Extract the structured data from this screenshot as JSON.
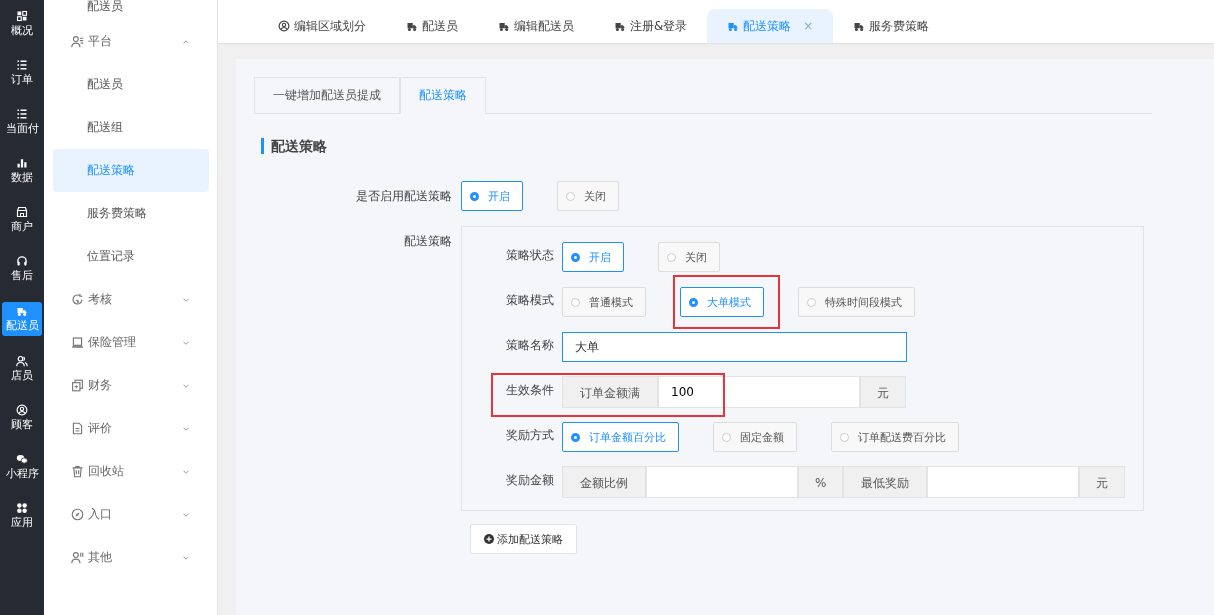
{
  "rail": [
    {
      "label": "概况",
      "selected": false
    },
    {
      "label": "订单",
      "selected": false
    },
    {
      "label": "当面付",
      "selected": false
    },
    {
      "label": "数据",
      "selected": false
    },
    {
      "label": "商户",
      "selected": false
    },
    {
      "label": "售后",
      "selected": false
    },
    {
      "label": "配送员",
      "selected": true
    },
    {
      "label": "店员",
      "selected": false
    },
    {
      "label": "顾客",
      "selected": false
    },
    {
      "label": "小程序",
      "selected": false
    },
    {
      "label": "应用",
      "selected": false
    }
  ],
  "sidebar": {
    "top_item": "配送员",
    "items": [
      {
        "label": "平台",
        "expanded": true,
        "children": [
          {
            "label": "配送员",
            "selected": false
          },
          {
            "label": "配送组",
            "selected": false
          },
          {
            "label": "配送策略",
            "selected": true
          },
          {
            "label": "服务费策略",
            "selected": false
          },
          {
            "label": "位置记录",
            "selected": false
          }
        ]
      },
      {
        "label": "考核",
        "expanded": false
      },
      {
        "label": "保险管理",
        "expanded": false
      },
      {
        "label": "财务",
        "expanded": false
      },
      {
        "label": "评价",
        "expanded": false
      },
      {
        "label": "回收站",
        "expanded": false
      },
      {
        "label": "入口",
        "expanded": false
      },
      {
        "label": "其他",
        "expanded": false
      }
    ]
  },
  "tabs": [
    {
      "label": "编辑区域划分",
      "selected": false
    },
    {
      "label": "配送员",
      "selected": false
    },
    {
      "label": "编辑配送员",
      "selected": false
    },
    {
      "label": "注册&登录",
      "selected": false
    },
    {
      "label": "配送策略",
      "selected": true
    },
    {
      "label": "服务费策略",
      "selected": false
    }
  ],
  "tab_close": "×",
  "inner_tabs": [
    {
      "label": "一键增加配送员提成",
      "selected": false
    },
    {
      "label": "配送策略",
      "selected": true
    }
  ],
  "section_title": "配送策略",
  "enable": {
    "label": "是否启用配送策略",
    "options": [
      {
        "label": "开启",
        "selected": true
      },
      {
        "label": "关闭",
        "selected": false
      }
    ]
  },
  "strategy_label": "配送策略",
  "strategy_rows": [
    {
      "kind": "radio",
      "label": "策略状态",
      "options": [
        {
          "label": "开启",
          "selected": true,
          "highlighted": false
        },
        {
          "label": "关闭",
          "selected": false,
          "highlighted": false
        }
      ]
    },
    {
      "kind": "radio",
      "label": "策略模式",
      "options": [
        {
          "label": "普通模式",
          "selected": false,
          "highlighted": false
        },
        {
          "label": "大单模式",
          "selected": true,
          "highlighted": true
        },
        {
          "label": "特殊时间段模式",
          "selected": false,
          "highlighted": false
        }
      ]
    },
    {
      "kind": "input",
      "label": "策略名称",
      "value": "大单"
    },
    {
      "kind": "group",
      "label": "生效条件",
      "highlighted": true,
      "groups": [
        {
          "prefix": "订单金额满",
          "value": "100",
          "suffix": "元"
        }
      ]
    },
    {
      "kind": "radio",
      "label": "奖励方式",
      "options": [
        {
          "label": "订单金额百分比",
          "selected": true,
          "highlighted": false
        },
        {
          "label": "固定金额",
          "selected": false,
          "highlighted": false
        },
        {
          "label": "订单配送费百分比",
          "selected": false,
          "highlighted": false
        }
      ]
    },
    {
      "kind": "group",
      "label": "奖励金额",
      "highlighted": false,
      "groups": [
        {
          "prefix": "金额比例",
          "suffix": "%"
        },
        {
          "prefix": "最低奖励",
          "suffix": "元"
        }
      ]
    }
  ],
  "add_button": "添加配送策略"
}
